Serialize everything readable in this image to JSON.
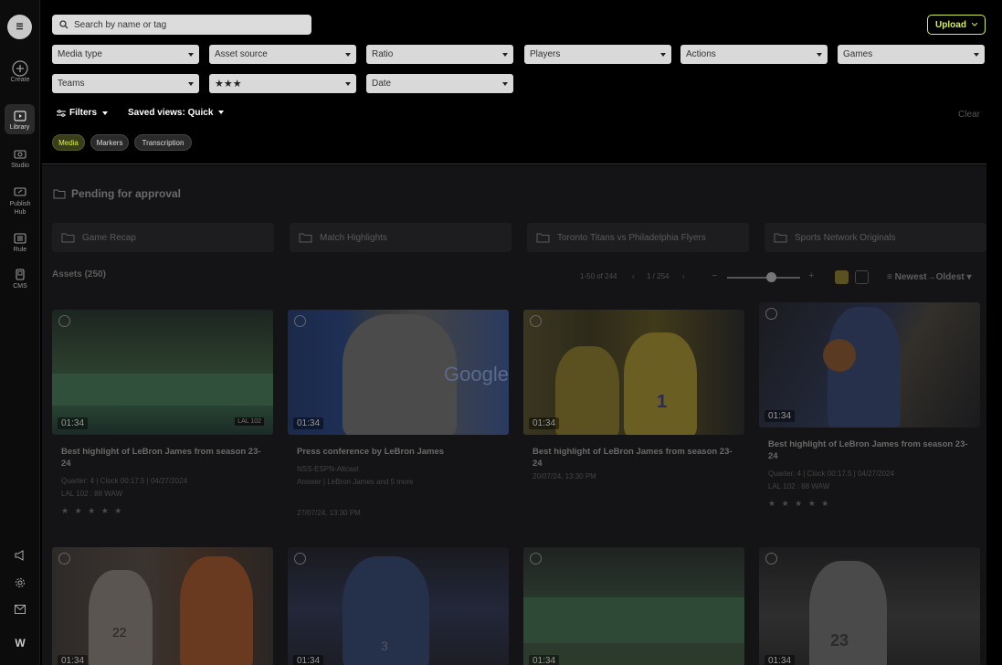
{
  "app": {
    "logo_text": "☰"
  },
  "sidebar": {
    "items": [
      {
        "label": "Create",
        "icon": "plus-circle-icon"
      },
      {
        "label": "Library",
        "icon": "play-folder-icon",
        "active": true
      },
      {
        "label": "Studio",
        "icon": "video-camera-icon"
      },
      {
        "label": "Publish Hub",
        "icon": "share-box-icon"
      },
      {
        "label": "Rule",
        "icon": "list-box-icon"
      },
      {
        "label": "CMS",
        "icon": "copy-icon"
      }
    ],
    "bottom": [
      "megaphone-icon",
      "gear-icon",
      "mail-icon",
      "brand-w-icon"
    ],
    "brand_mark": "W"
  },
  "search": {
    "placeholder": "Search by name or tag"
  },
  "upload": {
    "label": "Upload"
  },
  "filters": {
    "row1": [
      "Media type",
      "Asset source",
      "Ratio",
      "Players",
      "Actions",
      "Games"
    ],
    "row2": [
      "Teams",
      "★★★",
      "Date"
    ],
    "filters_label": "Filters",
    "saved_views_label": "Saved views: Quick",
    "clear_label": "Clear"
  },
  "tabs": [
    {
      "label": "Media",
      "active": true
    },
    {
      "label": "Markers"
    },
    {
      "label": "Transcription"
    }
  ],
  "pending": {
    "title": "Pending for approval",
    "folders": [
      "Game Recap",
      "Match Highlights",
      "Toronto Titans vs Philadelphia Flyers",
      "Sports Network Originals"
    ]
  },
  "assets": {
    "label": "Assets (250)",
    "range": "1-50 of 244",
    "page": "1 / 254",
    "sort": "Newest→Oldest",
    "accent": "#d6f04a",
    "cards": [
      {
        "duration": "01:34",
        "title": "Best highlight of LeBron James from season 23-24",
        "meta1": "Quarter: 4 | Clock 00:17.5 | 04/27/2024",
        "meta2": "LAL 102 : 88 WAW",
        "stars": "★ ★ ★ ★ ★"
      },
      {
        "duration": "01:34",
        "title": "Press conference by LeBron James",
        "meta1": "NSS-ESPN-Altcast",
        "meta2": "Answer | LeBron James and 5 more",
        "date": "27/07/24, 13:30 PM"
      },
      {
        "duration": "01:34",
        "title": "Best highlight of LeBron James from season 23-24",
        "meta1": "20/07/24, 13:30 PM"
      },
      {
        "duration": "01:34",
        "title": "Best highlight of LeBron James from season 23-24",
        "meta1": "Quarter: 4 | Clock 00:17.5 | 04/27/2024",
        "meta2": "LAL 102 : 88 WAW",
        "stars": "★ ★ ★ ★ ★"
      },
      {
        "duration": "01:34"
      },
      {
        "duration": "01:34"
      },
      {
        "duration": "01:34"
      },
      {
        "duration": "01:34"
      }
    ],
    "thumb_texts": {
      "google": "Google",
      "score": "LAL 102",
      "jersey_22": "22",
      "jersey_3": "3",
      "jersey_23": "23",
      "jersey_1": "1"
    }
  }
}
